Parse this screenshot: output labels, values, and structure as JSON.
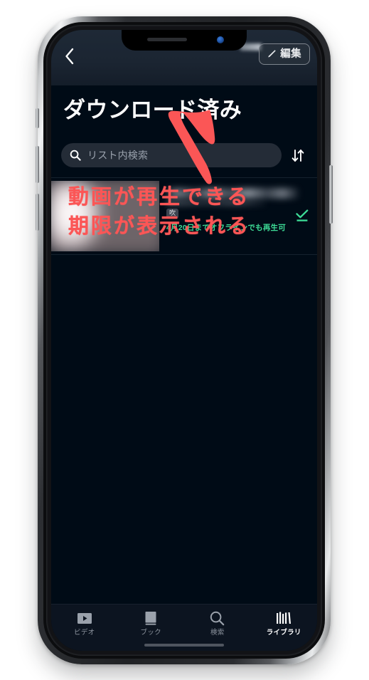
{
  "device": {
    "frame_label": "smartphone-mockup",
    "status_bar": {
      "notch_camera_icon": "camera-dot-icon",
      "notch_speaker_icon": "speaker-grille-icon",
      "right_indicators_state": "blurred"
    }
  },
  "colors": {
    "screen_background": "#000b16",
    "header_background": "#1b2532",
    "search_field_background": "#242c37",
    "accent_green": "#3ddc97",
    "annotation_red": "#fb5656",
    "tab_bar_background": "#0c1420",
    "active_tab_text": "#ffffff",
    "inactive_tab_text": "#8d949e"
  },
  "nav": {
    "back_icon": "chevron-left-icon",
    "edit_button": {
      "label": "編集",
      "icon": "pencil-icon"
    }
  },
  "header": {
    "title": "ダウンロード済み"
  },
  "search": {
    "icon": "search-icon",
    "placeholder": "リスト内検索",
    "value": "",
    "sort_icon": "sort-up-down-icon"
  },
  "list": {
    "items": [
      {
        "thumbnail_state": "blurred",
        "title_state": "blurred",
        "badge": "吹",
        "expiry_text": "4月20日までオフラインでも再生可",
        "status_icon": "downloaded-check-icon"
      }
    ]
  },
  "annotation": {
    "arrow_icon": "hand-drawn-up-arrow-icon",
    "line1": "動画が再生できる",
    "line2": "期限が表示される"
  },
  "tab_bar": {
    "items": [
      {
        "label": "ビデオ",
        "icon": "video-play-icon",
        "active": false
      },
      {
        "label": "ブック",
        "icon": "book-icon",
        "active": false
      },
      {
        "label": "検索",
        "icon": "search-icon",
        "active": false
      },
      {
        "label": "ライブラリ",
        "icon": "library-books-icon",
        "active": true
      }
    ]
  }
}
